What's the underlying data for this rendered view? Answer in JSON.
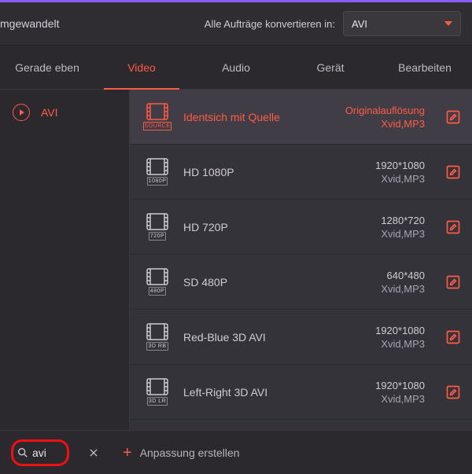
{
  "header": {
    "left_text": "mgewandelt",
    "convert_label": "Alle Aufträge konvertieren in:",
    "format_selected": "AVI"
  },
  "tabs": [
    {
      "label": "Gerade eben",
      "active": false
    },
    {
      "label": "Video",
      "active": true
    },
    {
      "label": "Audio",
      "active": false
    },
    {
      "label": "Gerät",
      "active": false
    },
    {
      "label": "Bearbeiten",
      "active": false
    }
  ],
  "sidebar": {
    "items": [
      {
        "label": "AVI",
        "icon": "play-icon"
      }
    ]
  },
  "presets": [
    {
      "icon_label": "SOURCE",
      "title": "Identsich mit Quelle",
      "resolution": "Originalauflösung",
      "codec": "Xvid,MP3",
      "active": true
    },
    {
      "icon_label": "1080P",
      "title": "HD 1080P",
      "resolution": "1920*1080",
      "codec": "Xvid,MP3",
      "active": false
    },
    {
      "icon_label": "720P",
      "title": "HD 720P",
      "resolution": "1280*720",
      "codec": "Xvid,MP3",
      "active": false
    },
    {
      "icon_label": "480P",
      "title": "SD 480P",
      "resolution": "640*480",
      "codec": "Xvid,MP3",
      "active": false
    },
    {
      "icon_label": "3D RB",
      "title": "Red-Blue 3D AVI",
      "resolution": "1920*1080",
      "codec": "Xvid,MP3",
      "active": false
    },
    {
      "icon_label": "3D LR",
      "title": "Left-Right 3D AVI",
      "resolution": "1920*1080",
      "codec": "Xvid,MP3",
      "active": false
    }
  ],
  "footer": {
    "search_value": "avi",
    "search_placeholder": "",
    "create_label": "Anpassung erstellen"
  }
}
